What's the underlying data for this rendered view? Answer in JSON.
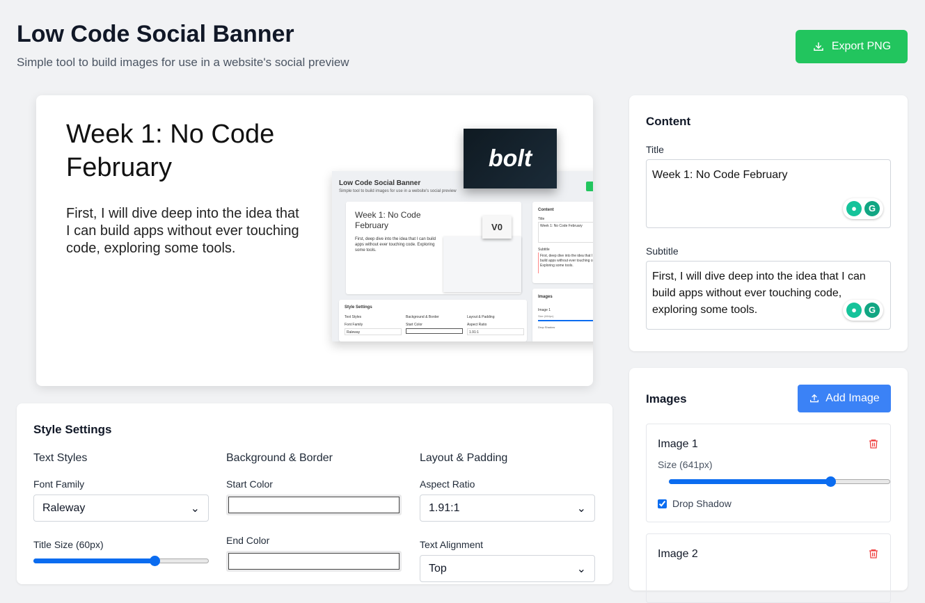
{
  "header": {
    "title": "Low Code Social Banner",
    "subtitle": "Simple tool to build images for use in a website's social preview",
    "export_label": "Export PNG"
  },
  "preview": {
    "title": "Week 1: No Code February",
    "subtitle": "First, I will dive deep into the idea that I can build apps without ever touching code, exploring some tools.",
    "images": [
      {
        "logo_text": "bolt"
      },
      {
        "screenshot": {
          "title": "Low Code Social Banner",
          "subtitle": "Simple tool to build images for use in a website's social preview",
          "banner_title": "Week 1: No Code February",
          "banner_subtitle": "First, deep dive into the idea that I can build apps without ever touching code. Exploring some tools.",
          "logo_text": "V0",
          "content_heading": "Content",
          "title_label": "Title",
          "title_value": "Week 1: No Code February",
          "subtitle_label": "Subtitle",
          "subtitle_value": "First, deep dive into the idea that I can build apps without ever touching code. Exploring some tools.",
          "images_heading": "Images",
          "image_label": "Image 1",
          "size_label": "Size (664px)",
          "shadow_label": "Drop Shadow",
          "style_heading": "Style Settings",
          "col1": "Text Styles",
          "col2": "Background & Border",
          "col3": "Layout & Padding",
          "font_family_label": "Font Family",
          "font_family_value": "Raleway",
          "start_color_label": "Start Color",
          "aspect_label": "Aspect Ratio",
          "aspect_value": "1.91:1"
        }
      }
    ]
  },
  "style_settings": {
    "heading": "Style Settings",
    "text_styles": {
      "heading": "Text Styles",
      "font_family_label": "Font Family",
      "font_family_value": "Raleway",
      "title_size_label": "Title Size (60px)",
      "title_size_fraction": 0.69
    },
    "background": {
      "heading": "Background & Border",
      "start_color_label": "Start Color",
      "end_color_label": "End Color",
      "start_color": "#ffffff",
      "end_color": "#ffffff"
    },
    "layout": {
      "heading": "Layout & Padding",
      "aspect_label": "Aspect Ratio",
      "aspect_value": "1.91:1",
      "alignment_label": "Text Alignment",
      "alignment_value": "Top"
    }
  },
  "content": {
    "heading": "Content",
    "title_label": "Title",
    "title_value": "Week 1: No Code February",
    "subtitle_label": "Subtitle",
    "subtitle_value": "First, I will dive deep into the idea that I can build apps without ever touching code, exploring some tools."
  },
  "images": {
    "heading": "Images",
    "add_label": "Add Image",
    "items": [
      {
        "label": "Image 1",
        "size_label": "Size (641px)",
        "size_fraction": 0.73,
        "shadow_label": "Drop Shadow",
        "shadow": true
      },
      {
        "label": "Image 2"
      }
    ]
  },
  "colors": {
    "export": "#22c55e",
    "add": "#3b82f6",
    "slider": "#0b6cf0",
    "trash": "#ef4444"
  }
}
